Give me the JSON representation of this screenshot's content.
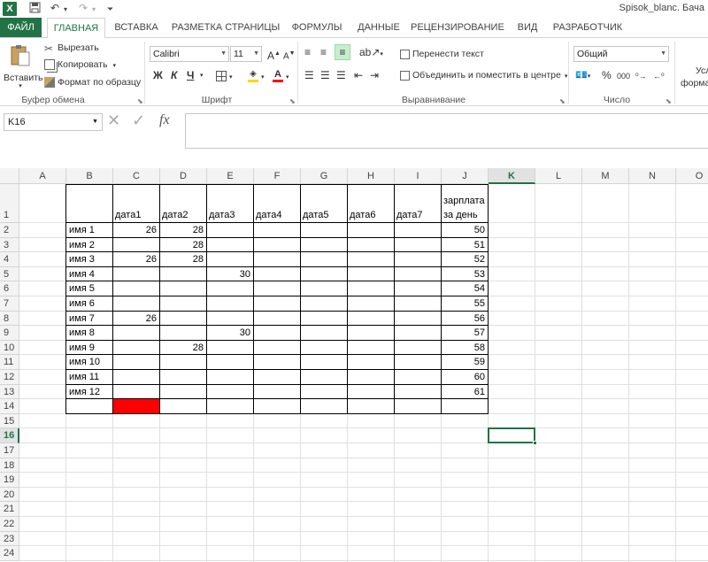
{
  "titlebar": {
    "app_icon": "X",
    "title": "Spisok_blanc. Бача"
  },
  "tabs": [
    "ФАЙЛ",
    "ГЛАВНАЯ",
    "ВСТАВКА",
    "РАЗМЕТКА СТРАНИЦЫ",
    "ФОРМУЛЫ",
    "ДАННЫЕ",
    "РЕЦЕНЗИРОВАНИЕ",
    "ВИД",
    "РАЗРАБОТЧИК"
  ],
  "ribbon": {
    "clipboard": {
      "paste": "Вставить",
      "cut": "Вырезать",
      "copy": "Копировать",
      "format_painter": "Формат по образцу",
      "label": "Буфер обмена"
    },
    "font": {
      "name": "Calibri",
      "size": "11",
      "bold": "Ж",
      "italic": "К",
      "underline": "Ч",
      "label": "Шрифт"
    },
    "alignment": {
      "wrap": "Перенести текст",
      "merge": "Объединить и поместить в центре",
      "label": "Выравнивание"
    },
    "number": {
      "format": "Общий",
      "label": "Число",
      "percent": "%",
      "thousands": "000"
    },
    "styles": {
      "label1": "Усл",
      "label2": "форма"
    }
  },
  "formula": {
    "namebox": "K16",
    "cancel": "✕",
    "enter": "✓",
    "fx": "fx",
    "value": ""
  },
  "columns": [
    "A",
    "B",
    "C",
    "D",
    "E",
    "F",
    "G",
    "H",
    "I",
    "J",
    "K",
    "L",
    "M",
    "N",
    "O"
  ],
  "rows": [
    "1",
    "2",
    "3",
    "4",
    "5",
    "6",
    "7",
    "8",
    "9",
    "10",
    "11",
    "12",
    "13",
    "14",
    "15",
    "16",
    "17",
    "18",
    "19",
    "20",
    "21",
    "22",
    "23",
    "24"
  ],
  "headers": {
    "B1": "",
    "C1": "дата1",
    "D1": "дата2",
    "E1": "дата3",
    "F1": "дата4",
    "G1": "дата5",
    "H1": "дата6",
    "I1": "дата7",
    "J1a": "зарплата",
    "J1b": "за день"
  },
  "names": [
    "имя 1",
    "имя 2",
    "имя 3",
    "имя 4",
    "имя 5",
    "имя 6",
    "имя 7",
    "имя 8",
    "имя 9",
    "имя 10",
    "имя 11",
    "имя 12"
  ],
  "values": [
    {
      "row": 2,
      "col": "C",
      "v": "26"
    },
    {
      "row": 2,
      "col": "D",
      "v": "28"
    },
    {
      "row": 3,
      "col": "D",
      "v": "28"
    },
    {
      "row": 4,
      "col": "C",
      "v": "26"
    },
    {
      "row": 4,
      "col": "D",
      "v": "28"
    },
    {
      "row": 5,
      "col": "E",
      "v": "30"
    },
    {
      "row": 8,
      "col": "C",
      "v": "26"
    },
    {
      "row": 9,
      "col": "E",
      "v": "30"
    },
    {
      "row": 10,
      "col": "D",
      "v": "28"
    }
  ],
  "salary": [
    "50",
    "51",
    "52",
    "53",
    "54",
    "55",
    "56",
    "57",
    "58",
    "59",
    "60",
    "61"
  ],
  "colors": {
    "accent": "#217346",
    "red_cell": "#ff0000"
  },
  "selected_cell": "K16"
}
